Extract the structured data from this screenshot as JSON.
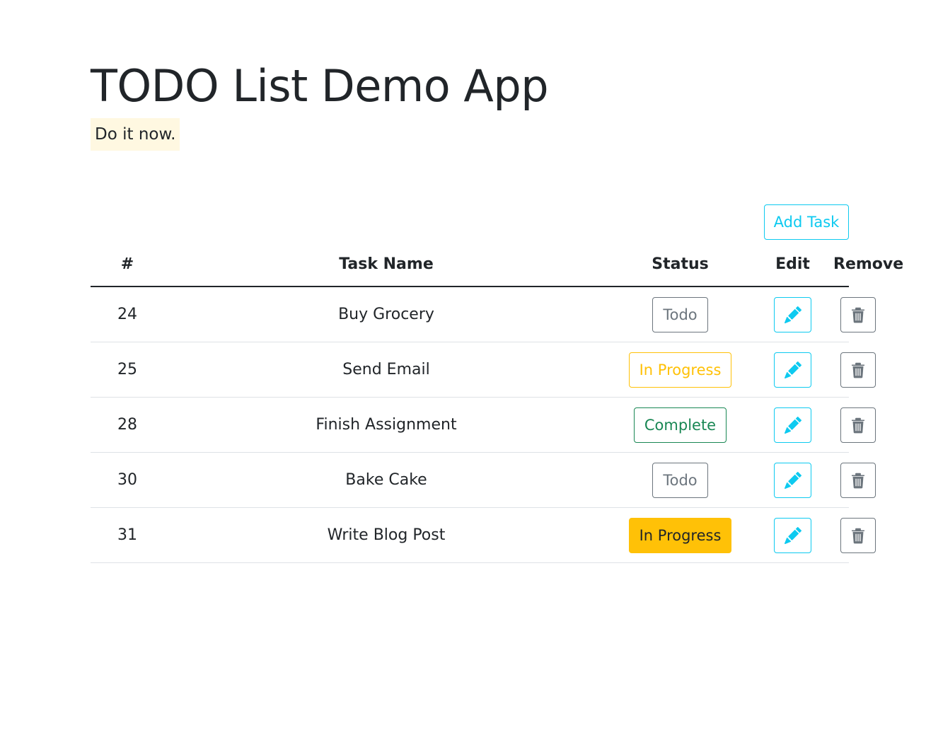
{
  "app": {
    "title": "TODO List Demo App",
    "tagline": "Do it now."
  },
  "toolbar": {
    "add_task_label": "Add Task"
  },
  "table": {
    "headers": {
      "id": "#",
      "task_name": "Task Name",
      "status": "Status",
      "edit": "Edit",
      "remove": "Remove"
    },
    "rows": [
      {
        "id": "24",
        "name": "Buy Grocery",
        "status": "Todo",
        "status_style": "outline-secondary"
      },
      {
        "id": "25",
        "name": "Send Email",
        "status": "In Progress",
        "status_style": "outline-warning"
      },
      {
        "id": "28",
        "name": "Finish Assignment",
        "status": "Complete",
        "status_style": "outline-success"
      },
      {
        "id": "30",
        "name": "Bake Cake",
        "status": "Todo",
        "status_style": "outline-secondary"
      },
      {
        "id": "31",
        "name": "Write Blog Post",
        "status": "In Progress",
        "status_style": "solid-warning"
      }
    ]
  },
  "icons": {
    "edit": "pencil-icon",
    "remove": "trash-icon"
  },
  "colors": {
    "info": "#0dcaf0",
    "secondary": "#6c757d",
    "warning": "#ffc107",
    "success": "#198754",
    "tagline_bg": "#fff8e1",
    "text": "#212529"
  }
}
